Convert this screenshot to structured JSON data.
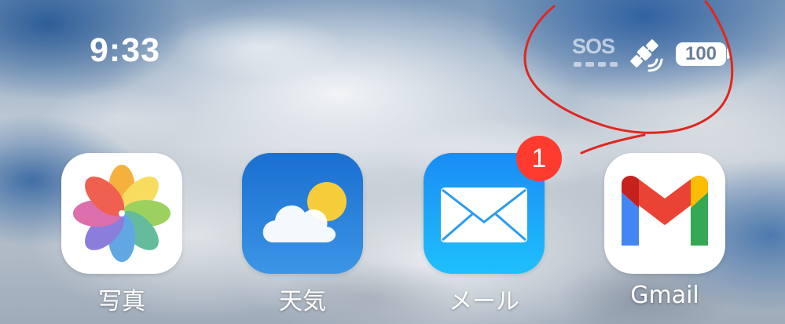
{
  "status_bar": {
    "time": "9:33",
    "sos_label": "SOS",
    "satellite_icon": "satellite-icon",
    "battery_level": "100"
  },
  "apps": [
    {
      "label": "写真",
      "icon": "photos-icon"
    },
    {
      "label": "天気",
      "icon": "weather-icon"
    },
    {
      "label": "メール",
      "icon": "mail-icon",
      "badge": "1"
    },
    {
      "label": "Gmail",
      "icon": "gmail-icon"
    }
  ],
  "colors": {
    "badge": "#ff3b30",
    "annotation": "#e0271e",
    "weather_top": "#1a6fd0",
    "mail_top": "#1a8cf5"
  }
}
